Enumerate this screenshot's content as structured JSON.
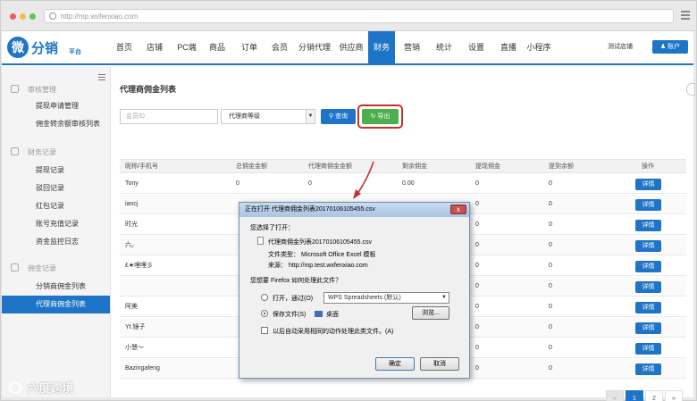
{
  "browser": {
    "url": "http://mp.wxfenxiao.com"
  },
  "header": {
    "logo_main": "分销",
    "logo_glyph": "微",
    "logo_sub": "平台",
    "nav": [
      "首页",
      "店铺",
      "PC端",
      "商品",
      "订单",
      "会员",
      "分销代理",
      "供应商",
      "财务",
      "营销",
      "统计",
      "设置",
      "直播",
      "小程序"
    ],
    "active_nav": "财务",
    "shop_name": "测试店铺",
    "account_label": "账户",
    "accent_color": "#1e74c6"
  },
  "sidebar": {
    "groups": [
      {
        "title": "审核管理",
        "items": [
          "提现申请管理",
          "佣金转余额审核列表"
        ]
      },
      {
        "title": "财务记录",
        "items": [
          "提现记录",
          "驳回记录",
          "红包记录",
          "账号充值记录",
          "资金监控日志"
        ]
      },
      {
        "title": "佣金记录",
        "items": [
          "分销商佣金列表",
          "代理商佣金列表"
        ]
      }
    ],
    "active_item": "代理商佣金列表"
  },
  "main": {
    "title": "代理商佣金列表",
    "filter": {
      "member_placeholder": "会员ID",
      "level_select": "代理商等级",
      "search_label": "查询",
      "export_label": "导出"
    },
    "table": {
      "columns": [
        "昵称/手机号",
        "总佣金金额",
        "代理商佣金金额",
        "剩余佣金",
        "提现佣金",
        "提到余额",
        "操作"
      ],
      "action_label": "详情",
      "rows": [
        [
          "Tony",
          "0",
          "0",
          "0.00",
          "0",
          "0"
        ],
        [
          "iancj",
          "",
          "",
          "",
          "0",
          "0"
        ],
        [
          "时光",
          "",
          "",
          "",
          "0",
          "0"
        ],
        [
          "六。",
          "",
          "",
          "",
          "0",
          "0"
        ],
        [
          "£★哩哩彡",
          "",
          "",
          "",
          "0",
          "0"
        ],
        [
          "",
          "",
          "",
          "",
          "0",
          "0"
        ],
        [
          "阿美",
          "",
          "",
          "",
          "0",
          "0"
        ],
        [
          "Yt.镜子",
          "",
          "",
          "",
          "0",
          "0"
        ],
        [
          "小慧～",
          "",
          "",
          "",
          "0",
          "0"
        ],
        [
          "Bazingafeng",
          "",
          "",
          "",
          "0",
          "0"
        ]
      ]
    },
    "pagination": {
      "prev": "«",
      "pages": [
        "1",
        "2"
      ],
      "active_page": "1",
      "next": "»"
    }
  },
  "dialog": {
    "title": "正在打开 代理商佣金列表20170106105455.csv",
    "close_label": "x",
    "chosen_label": "您选择了打开：",
    "file_name": "代理商佣金列表20170106105455.csv",
    "file_type": "文件类型： Microsoft Office Excel 模板",
    "source": "来源： http://mp.test.wxfenxiao.com",
    "question": "您想要 Firefox 如何处理此文件？",
    "open_with_label": "打开，通过(O)",
    "open_with_app": "WPS Spreadsheets (默认)",
    "save_file_label": "保存文件(S)",
    "save_location": "桌面",
    "browse_label": "浏览...",
    "auto_label": "以后自动采用相同的动作处理此类文件。(A)",
    "ok_label": "确定",
    "cancel_label": "取消"
  },
  "watermark": {
    "text": "六度跨境"
  }
}
